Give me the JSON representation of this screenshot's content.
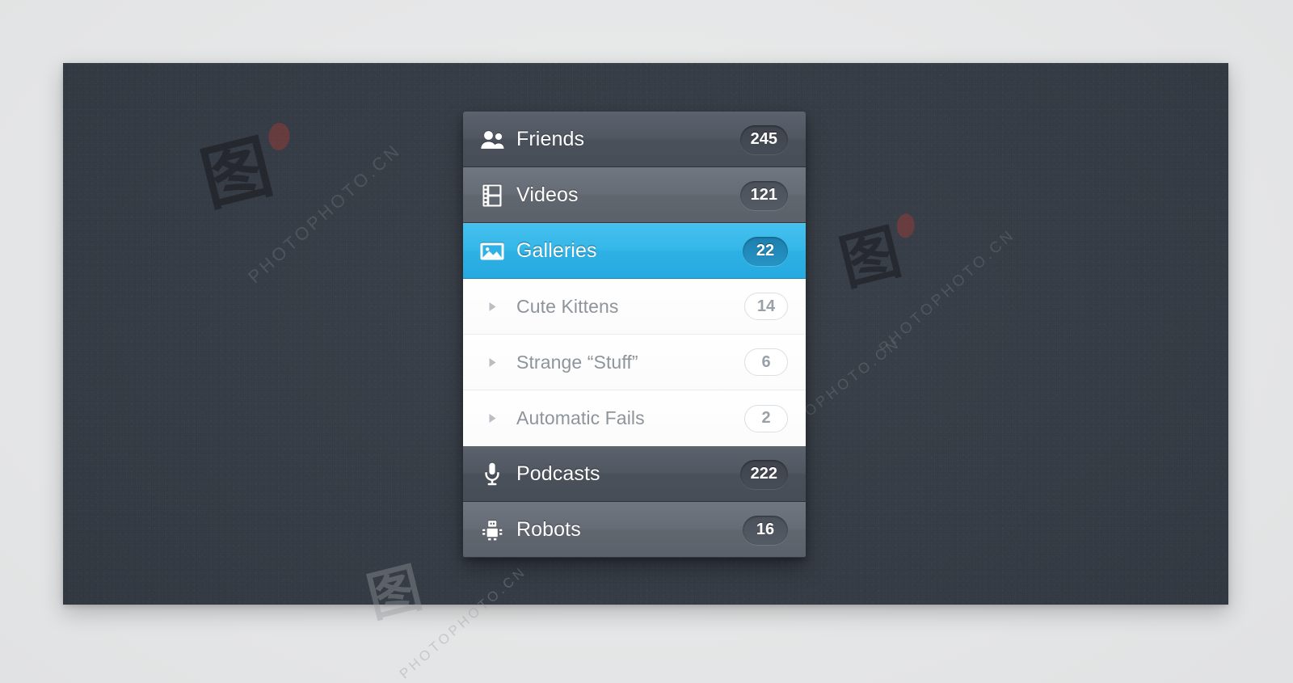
{
  "menu": {
    "items": [
      {
        "id": "friends",
        "label": "Friends",
        "count": "245",
        "icon": "people-icon",
        "state": "normal",
        "tone": "dark-a"
      },
      {
        "id": "videos",
        "label": "Videos",
        "count": "121",
        "icon": "film-strip-icon",
        "state": "normal",
        "tone": "dark-b"
      },
      {
        "id": "galleries",
        "label": "Galleries",
        "count": "22",
        "icon": "image-icon",
        "state": "selected",
        "tone": "active"
      },
      {
        "id": "podcasts",
        "label": "Podcasts",
        "count": "222",
        "icon": "microphone-icon",
        "state": "normal",
        "tone": "dark-a"
      },
      {
        "id": "robots",
        "label": "Robots",
        "count": "16",
        "icon": "robot-icon",
        "state": "normal",
        "tone": "dark-b"
      }
    ],
    "submenu": {
      "parent": "galleries",
      "items": [
        {
          "id": "cute-kittens",
          "label": "Cute Kittens",
          "count": "14",
          "icon": "disclosure-triangle-icon",
          "expanded": false
        },
        {
          "id": "strange-stuff",
          "label": "Strange “Stuff”",
          "count": "6",
          "icon": "disclosure-triangle-icon",
          "expanded": false
        },
        {
          "id": "automatic-fails",
          "label": "Automatic Fails",
          "count": "2",
          "icon": "disclosure-triangle-icon",
          "expanded": false
        }
      ]
    }
  },
  "watermarks": [
    {
      "id": "wm-1",
      "glyph": "图",
      "text": "PHOTOPHOTO.CN"
    },
    {
      "id": "wm-2",
      "glyph": "图",
      "text": "PHOTOPHOTO.CN"
    },
    {
      "id": "wm-3",
      "glyph": "图",
      "text": "PHOTOPHOTO.CN"
    },
    {
      "id": "wm-4",
      "glyph": "图",
      "text": "PHOTOPHOTO.CN"
    }
  ],
  "colors": {
    "accent": "#2eb2e5",
    "accent_badge": "#1d7fae",
    "row_dark_a": "#4b515b",
    "row_dark_b": "#61676f",
    "stage_bg": "#343a43",
    "page_bg": "#e7e8e9",
    "submenu_bg": "#ffffff",
    "submenu_text": "#8e949b"
  }
}
